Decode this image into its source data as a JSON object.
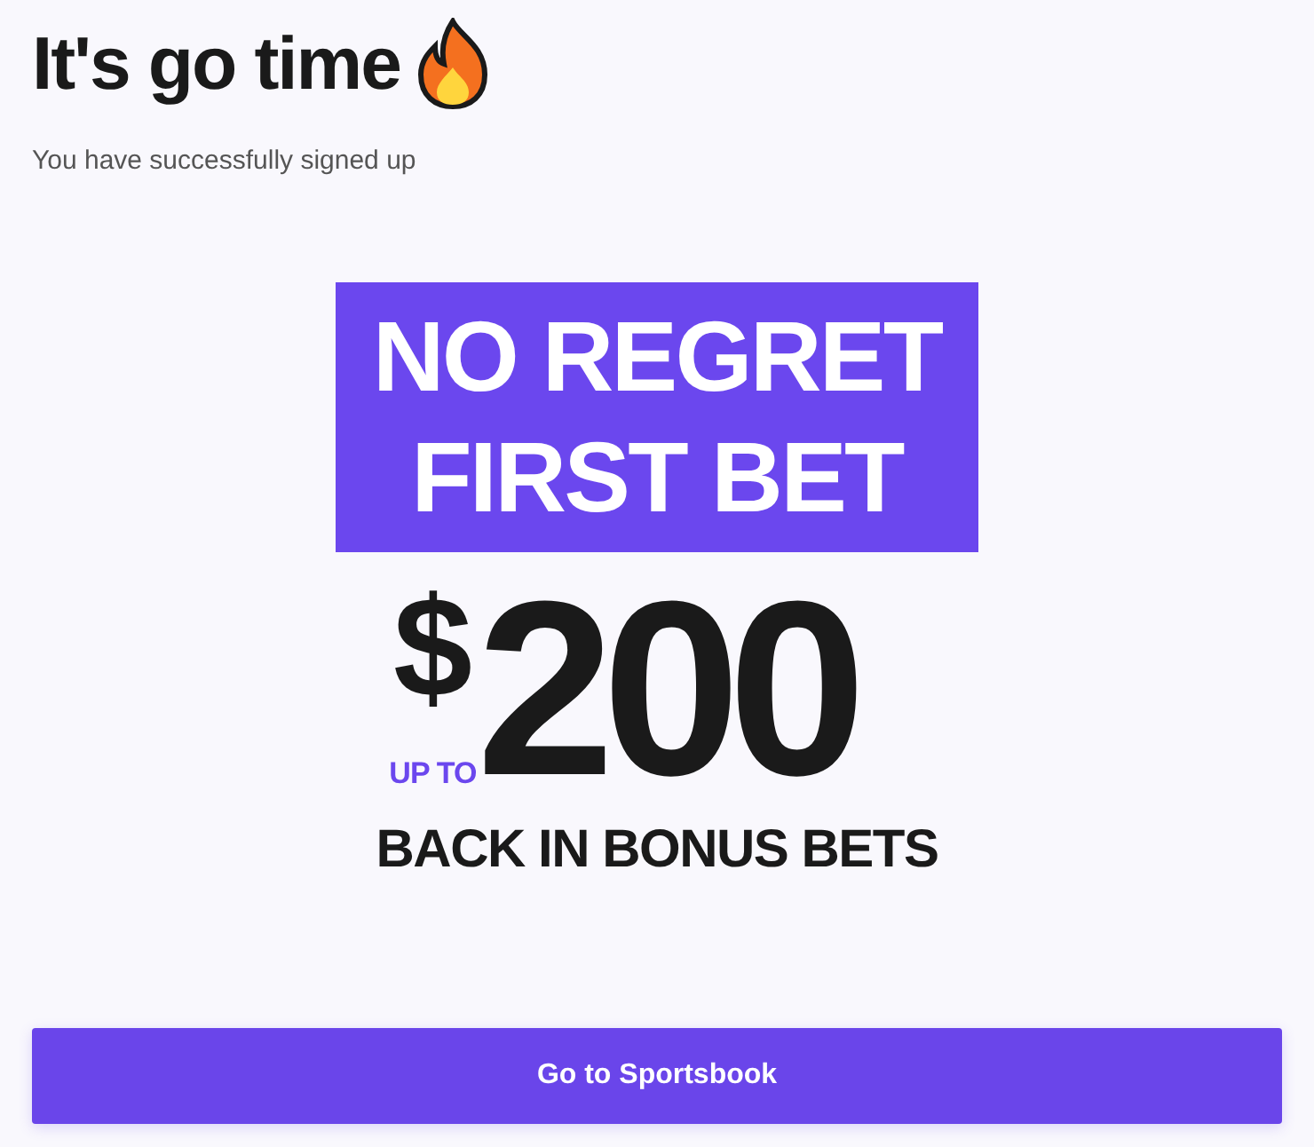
{
  "heading": "It's go time",
  "subtitle": "You have successfully signed up",
  "promo": {
    "banner_lines": [
      "NO REGRET",
      "FIRST BET"
    ],
    "currency": "$",
    "amount": "200",
    "prefix": "UP TO",
    "tagline": "BACK IN BONUS BETS"
  },
  "button": "Go to Sportsbook"
}
